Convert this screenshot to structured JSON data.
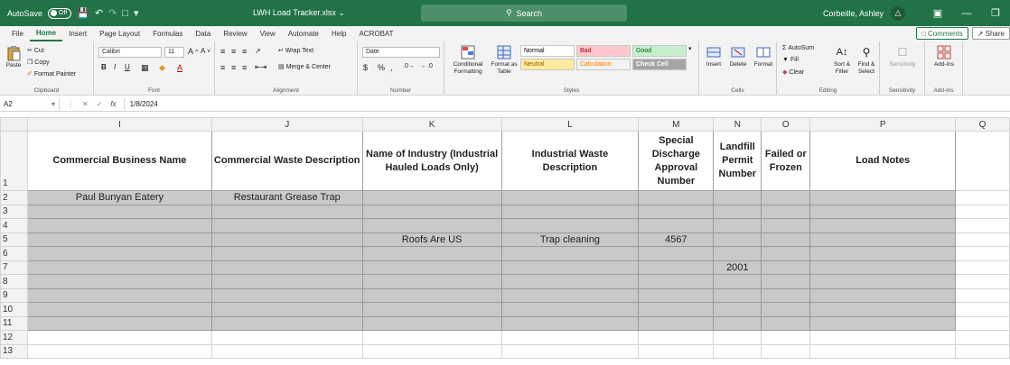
{
  "titlebar": {
    "autosave_label": "AutoSave",
    "autosave_state": "Off",
    "filename": "LWH Load Tracker.xlsx",
    "search_placeholder": "Search",
    "user_name": "Corbeille, Ashley",
    "bg_color": "#217346"
  },
  "menu": {
    "tabs": [
      "File",
      "Home",
      "Insert",
      "Page Layout",
      "Formulas",
      "Data",
      "Review",
      "View",
      "Automate",
      "Help",
      "ACROBAT"
    ],
    "active_tab": "Home",
    "comments_label": "Comments",
    "share_label": "Share"
  },
  "ribbon": {
    "clipboard": {
      "paste": "Paste",
      "cut": "Cut",
      "copy": "Copy",
      "format_painter": "Format Painter",
      "label": "Clipboard"
    },
    "font": {
      "name": "Calibri",
      "size": "11",
      "label": "Font"
    },
    "alignment": {
      "wrap_text": "Wrap Text",
      "merge_center": "Merge & Center",
      "label": "Alignment"
    },
    "number": {
      "format": "Date",
      "label": "Number"
    },
    "styles": {
      "conditional": "Conditional Formatting",
      "format_as_table": "Format as Table",
      "cells": [
        {
          "label": "Normal",
          "bg": "#ffffff",
          "fg": "#000000"
        },
        {
          "label": "Bad",
          "bg": "#ffc7ce",
          "fg": "#9c0006"
        },
        {
          "label": "Good",
          "bg": "#c6efce",
          "fg": "#006100"
        },
        {
          "label": "Neutral",
          "bg": "#ffeb9c",
          "fg": "#9c5700"
        },
        {
          "label": "Calculation",
          "bg": "#f2f2f2",
          "fg": "#fa7d00"
        },
        {
          "label": "Check Cell",
          "bg": "#a5a5a5",
          "fg": "#ffffff"
        }
      ],
      "label": "Styles"
    },
    "cells": {
      "insert": "Insert",
      "delete": "Delete",
      "format": "Format",
      "label": "Cells"
    },
    "editing": {
      "autosum": "AutoSum",
      "fill": "Fill",
      "clear": "Clear",
      "sort_filter": "Sort & Filter",
      "find_select": "Find & Select",
      "label": "Editing"
    },
    "sensitivity": {
      "button": "Sensitivity",
      "label": "Sensitivity"
    },
    "addins": {
      "button": "Add-ins",
      "label": "Add-ins"
    }
  },
  "formula_bar": {
    "name_box": "A2",
    "fx": "fx",
    "value": "1/8/2024"
  },
  "sheet": {
    "columns": [
      "I",
      "J",
      "K",
      "L",
      "M",
      "N",
      "O",
      "P",
      "Q"
    ],
    "headers": [
      "Commercial Business Name",
      "Commercial Waste Description",
      "Name of Industry (Industrial Hauled Loads Only)",
      "Industrial Waste Description",
      "Special Discharge Approval Number",
      "Landfill Permit Number",
      "Failed or Frozen",
      "Load Notes",
      ""
    ],
    "header_row_number": "1",
    "rows": [
      {
        "num": "2",
        "filled": true,
        "cells": [
          "Paul Bunyan Eatery",
          "Restaurant Grease Trap",
          "",
          "",
          "",
          "",
          "",
          "",
          ""
        ]
      },
      {
        "num": "3",
        "filled": true,
        "cells": [
          "",
          "",
          "",
          "",
          "",
          "",
          "",
          "",
          ""
        ]
      },
      {
        "num": "4",
        "filled": true,
        "cells": [
          "",
          "",
          "",
          "",
          "",
          "",
          "",
          "",
          ""
        ]
      },
      {
        "num": "5",
        "filled": true,
        "cells": [
          "",
          "",
          "Roofs Are US",
          "Trap cleaning",
          "4567",
          "",
          "",
          "",
          ""
        ]
      },
      {
        "num": "6",
        "filled": true,
        "cells": [
          "",
          "",
          "",
          "",
          "",
          "",
          "",
          "",
          ""
        ]
      },
      {
        "num": "7",
        "filled": true,
        "cells": [
          "",
          "",
          "",
          "",
          "",
          "2001",
          "",
          "",
          ""
        ]
      },
      {
        "num": "8",
        "filled": true,
        "cells": [
          "",
          "",
          "",
          "",
          "",
          "",
          "",
          "",
          ""
        ]
      },
      {
        "num": "9",
        "filled": true,
        "cells": [
          "",
          "",
          "",
          "",
          "",
          "",
          "",
          "",
          ""
        ]
      },
      {
        "num": "10",
        "filled": true,
        "cells": [
          "",
          "",
          "",
          "",
          "",
          "",
          "",
          "",
          ""
        ]
      },
      {
        "num": "11",
        "filled": true,
        "cells": [
          "",
          "",
          "",
          "",
          "",
          "",
          "",
          "",
          ""
        ]
      },
      {
        "num": "12",
        "filled": false,
        "cells": [
          "",
          "",
          "",
          "",
          "",
          "",
          "",
          "",
          ""
        ]
      },
      {
        "num": "13",
        "filled": false,
        "cells": [
          "",
          "",
          "",
          "",
          "",
          "",
          "",
          "",
          ""
        ]
      }
    ]
  }
}
